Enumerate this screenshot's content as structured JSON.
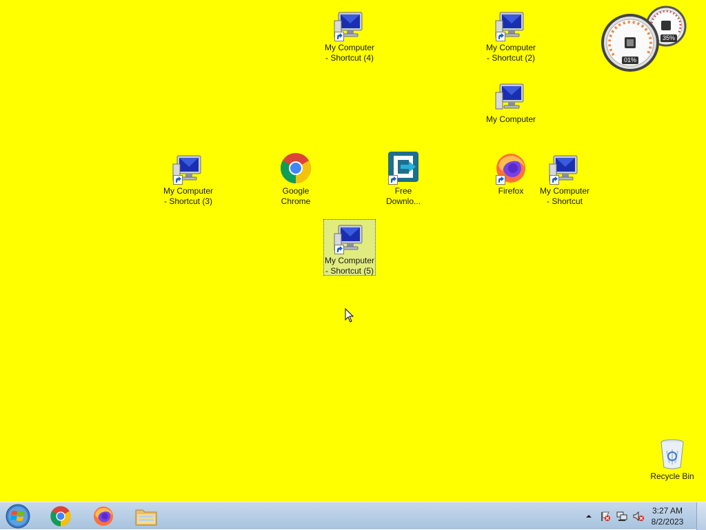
{
  "desktop": {
    "background_color": "#ffff00",
    "icons": [
      {
        "name": "desktop-icon-my-computer-shortcut-4",
        "label": "My Computer\n- Shortcut (4)",
        "icon": "computer-icon",
        "shortcut": true,
        "selected": false
      },
      {
        "name": "desktop-icon-my-computer-shortcut-2",
        "label": "My Computer\n- Shortcut (2)",
        "icon": "computer-icon",
        "shortcut": true,
        "selected": false
      },
      {
        "name": "desktop-icon-my-computer",
        "label": "My Computer",
        "icon": "computer-icon",
        "shortcut": false,
        "selected": false
      },
      {
        "name": "desktop-icon-my-computer-shortcut-3",
        "label": "My Computer\n- Shortcut (3)",
        "icon": "computer-icon",
        "shortcut": true,
        "selected": false
      },
      {
        "name": "desktop-icon-google-chrome",
        "label": "Google\nChrome",
        "icon": "chrome-icon",
        "shortcut": false,
        "selected": false
      },
      {
        "name": "desktop-icon-free-download-manager",
        "label": "Free\nDownlo...",
        "icon": "free-download-manager-icon",
        "shortcut": true,
        "selected": false
      },
      {
        "name": "desktop-icon-firefox",
        "label": "Firefox",
        "icon": "firefox-icon",
        "shortcut": true,
        "selected": false
      },
      {
        "name": "desktop-icon-my-computer-shortcut",
        "label": "My Computer\n- Shortcut",
        "icon": "computer-icon",
        "shortcut": true,
        "selected": false
      },
      {
        "name": "desktop-icon-my-computer-shortcut-5",
        "label": "My Computer\n- Shortcut (5)",
        "icon": "computer-icon",
        "shortcut": true,
        "selected": true
      },
      {
        "name": "desktop-icon-recycle-bin",
        "label": "Recycle Bin",
        "icon": "recycle-bin-icon",
        "shortcut": false,
        "selected": false
      }
    ]
  },
  "gadget": {
    "cpu_percent": "01%",
    "memory_percent": "35%"
  },
  "taskbar": {
    "pinned": [
      {
        "name": "taskbar-chrome",
        "icon": "chrome-icon"
      },
      {
        "name": "taskbar-firefox",
        "icon": "firefox-icon"
      },
      {
        "name": "taskbar-file-explorer",
        "icon": "folder-icon"
      }
    ],
    "tray": {
      "icons": [
        "show-hidden-icons-icon",
        "action-center-flag-icon",
        "network-icon",
        "volume-muted-icon"
      ],
      "time": "3:27 AM",
      "date": "8/2/2023"
    }
  }
}
